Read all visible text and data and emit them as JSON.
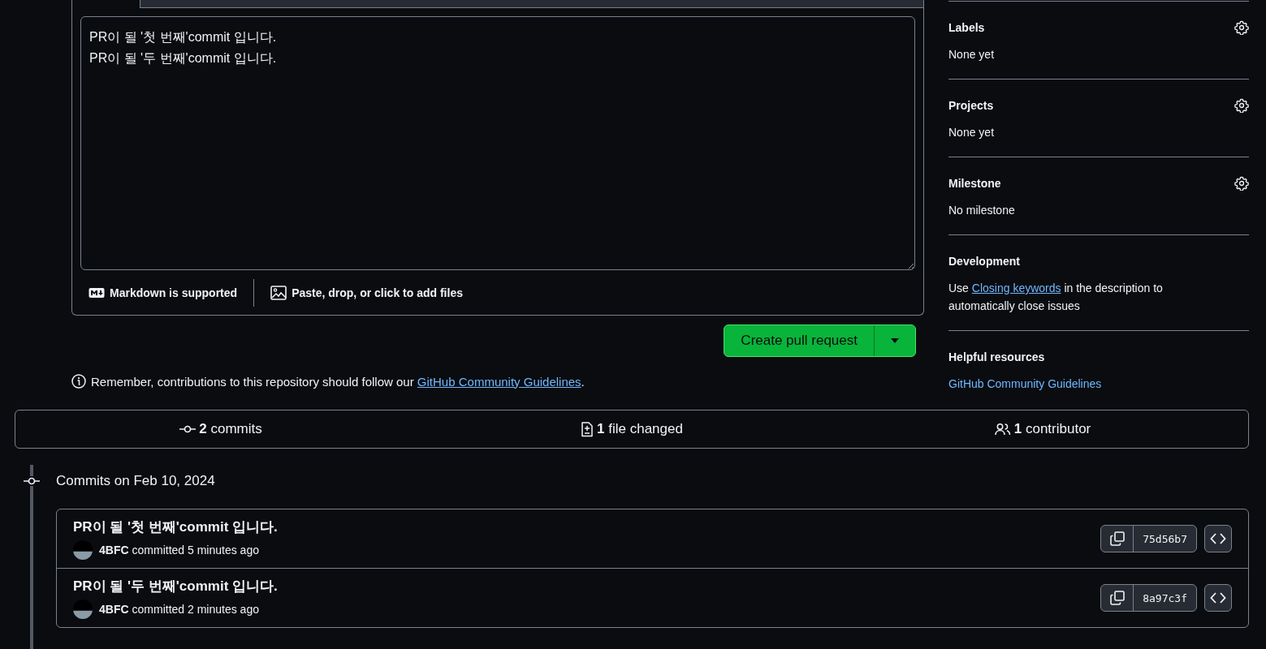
{
  "composer": {
    "body_lines": [
      "PR이 될 '첫 번째'commit 입니다.",
      "PR이 될 '두 번째'commit 입니다."
    ],
    "markdown_note": "Markdown is supported",
    "attach_note": "Paste, drop, or click to add files"
  },
  "create_button": {
    "label": "Create pull request"
  },
  "guidelines_note": {
    "text": "Remember, contributions to this repository should follow our",
    "link": "GitHub Community Guidelines",
    "end": "."
  },
  "sidebar": {
    "sections": [
      {
        "kind": "setting",
        "title": "Labels",
        "value": "None yet"
      },
      {
        "kind": "setting",
        "title": "Projects",
        "value": "None yet"
      },
      {
        "kind": "setting",
        "title": "Milestone",
        "value": "No milestone"
      },
      {
        "kind": "development",
        "title": "Development",
        "text_before": "Use",
        "link": "Closing keywords",
        "text_after": "in the description to automatically close issues"
      },
      {
        "kind": "resources",
        "title": "Helpful resources",
        "link": "GitHub Community Guidelines"
      }
    ]
  },
  "summary": [
    {
      "kind": "commits",
      "count": "2",
      "label": "commits"
    },
    {
      "kind": "files",
      "count": "1",
      "label": "file changed"
    },
    {
      "kind": "contributors",
      "count": "1",
      "label": "contributor"
    }
  ],
  "commit_group": {
    "date_heading": "Commits on Feb 10, 2024",
    "commits": [
      {
        "title": "PR이 될 '첫 번째'commit 입니다.",
        "author": "4BFC",
        "time": "committed 5 minutes ago",
        "sha": "75d56b7"
      },
      {
        "title": "PR이 될 '두 번째'commit 입니다.",
        "author": "4BFC",
        "time": "committed 2 minutes ago",
        "sha": "8a97c3f"
      }
    ]
  }
}
